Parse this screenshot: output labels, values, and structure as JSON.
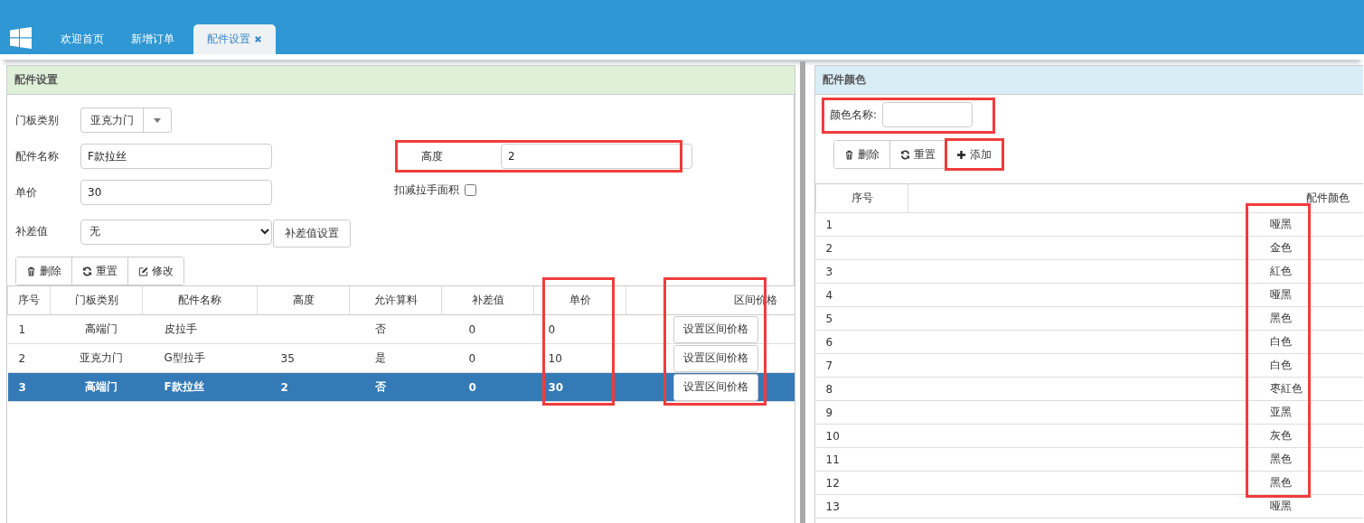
{
  "header": {
    "tabs": [
      {
        "label": "欢迎首页",
        "selected": false,
        "closable": false
      },
      {
        "label": "新增订单",
        "selected": false,
        "closable": false
      },
      {
        "label": "配件设置",
        "selected": true,
        "closable": true
      }
    ]
  },
  "left_panel": {
    "title": "配件设置",
    "form": {
      "door_type": {
        "label": "门板类别",
        "value": "亚克力门"
      },
      "part_name": {
        "label": "配件名称",
        "value": "F款拉丝"
      },
      "height": {
        "label": "高度",
        "value": "2",
        "highlighted": true
      },
      "unit_price": {
        "label": "单价",
        "value": "30"
      },
      "deduct_handle_area": {
        "label": "扣减拉手面积",
        "checked": false
      },
      "surcharge": {
        "label": "补差值",
        "value": "无",
        "button": "补差值设置"
      }
    },
    "buttons": [
      {
        "label": "删除",
        "kind": "delete",
        "highlighted": false
      },
      {
        "label": "重置",
        "kind": "reset",
        "highlighted": false
      },
      {
        "label": "修改",
        "kind": "edit",
        "highlighted": false
      }
    ],
    "table": {
      "columns": [
        {
          "label": "序号",
          "highlighted": false
        },
        {
          "label": "门板类别",
          "highlighted": false
        },
        {
          "label": "配件名称",
          "highlighted": false
        },
        {
          "label": "高度",
          "highlighted": false
        },
        {
          "label": "允许算料",
          "highlighted": false
        },
        {
          "label": "补差值",
          "highlighted": false
        },
        {
          "label": "单价",
          "highlighted": true
        },
        {
          "label": "区间价格",
          "highlighted": true
        }
      ],
      "rows": [
        {
          "cells": [
            "1",
            "高端门",
            "皮拉手",
            "",
            "否",
            "0",
            "0"
          ],
          "action": "设置区间价格",
          "selected": false
        },
        {
          "cells": [
            "2",
            "亚克力门",
            "G型拉手",
            "35",
            "是",
            "0",
            "10"
          ],
          "action": "设置区间价格",
          "selected": false
        },
        {
          "cells": [
            "3",
            "高端门",
            "F款拉丝",
            "2",
            "否",
            "0",
            "30"
          ],
          "action": "设置区间价格",
          "selected": true
        }
      ]
    }
  },
  "right_panel": {
    "title": "配件颜色",
    "color_name": {
      "label": "颜色名称:",
      "highlighted": true
    },
    "buttons": [
      {
        "label": "删除",
        "kind": "delete",
        "highlighted": false
      },
      {
        "label": "重置",
        "kind": "reset",
        "highlighted": false
      },
      {
        "label": "添加",
        "kind": "add",
        "highlighted": true
      }
    ],
    "table": {
      "columns": [
        {
          "label": "序号",
          "highlighted": false
        },
        {
          "label": "配件颜色",
          "highlighted": true
        }
      ],
      "rows": [
        {
          "cells": [
            "1",
            "哑黑"
          ]
        },
        {
          "cells": [
            "2",
            "金色"
          ]
        },
        {
          "cells": [
            "3",
            "紅色"
          ]
        },
        {
          "cells": [
            "4",
            "哑黑"
          ]
        },
        {
          "cells": [
            "5",
            "黑色"
          ]
        },
        {
          "cells": [
            "6",
            "白色"
          ]
        },
        {
          "cells": [
            "7",
            "白色"
          ]
        },
        {
          "cells": [
            "8",
            "枣紅色"
          ]
        },
        {
          "cells": [
            "9",
            "亚黑"
          ]
        },
        {
          "cells": [
            "10",
            "灰色"
          ]
        },
        {
          "cells": [
            "11",
            "黑色"
          ]
        },
        {
          "cells": [
            "12",
            "黑色"
          ]
        },
        {
          "cells": [
            "13",
            "哑黑"
          ]
        }
      ]
    }
  }
}
